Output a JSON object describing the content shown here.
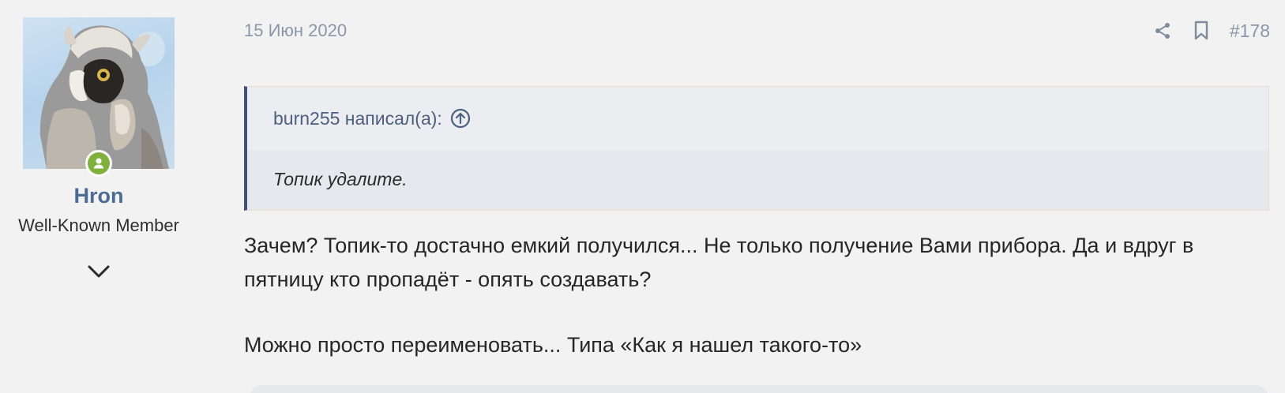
{
  "user": {
    "name": "Hron",
    "title": "Well-Known Member",
    "online_icon": "user-icon",
    "expand_icon": "chevron-down-icon"
  },
  "post": {
    "date": "15 Июн 2020",
    "number": "#178",
    "share_icon": "share-icon",
    "bookmark_icon": "bookmark-icon",
    "quote": {
      "author": "burn255 написал(а):",
      "jump_icon": "arrow-up-circle-icon",
      "text": "Топик удалите."
    },
    "body": [
      "Зачем? Топик-то достачно емкий получился... Не только получение Вами прибора. Да и вдруг в пятницу кто пропадёт - опять создавать?",
      "Можно просто переименовать... Типа «Как я нашел такого-то»"
    ]
  },
  "colors": {
    "username": "#4d6c94",
    "quote_border": "#40507a",
    "online": "#7fb13c",
    "muted": "#8a97a8"
  }
}
